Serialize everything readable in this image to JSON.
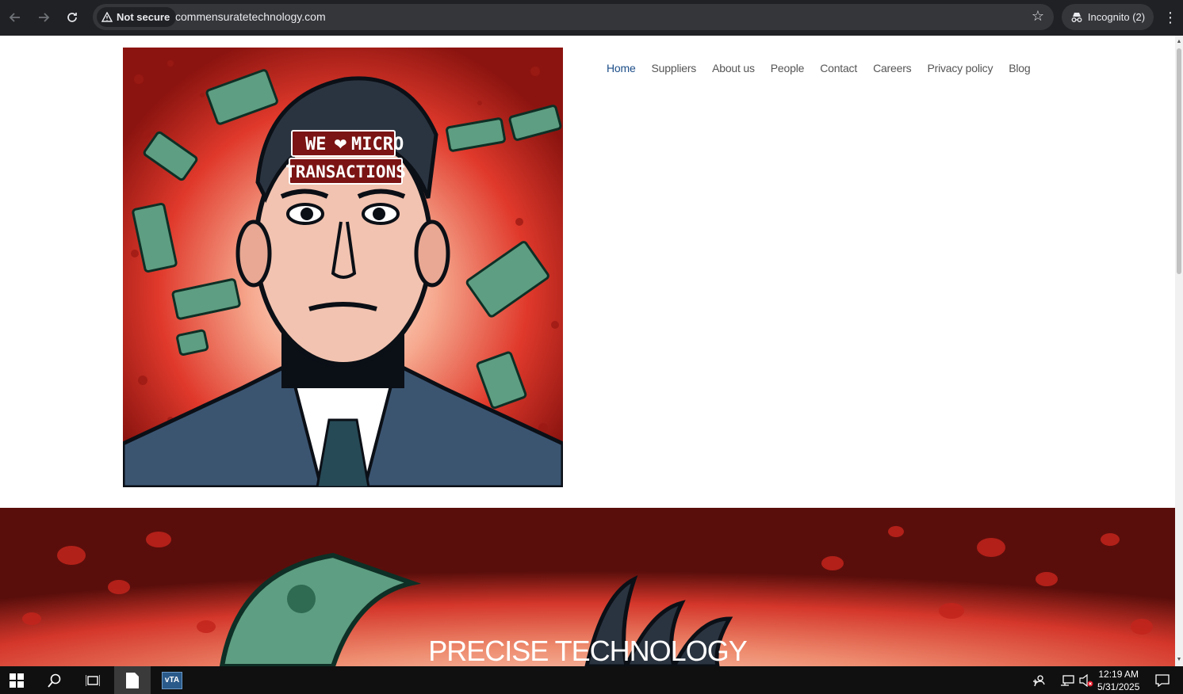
{
  "browser": {
    "back_icon": "arrow-left-icon",
    "forward_icon": "arrow-right-icon",
    "reload_icon": "reload-icon",
    "security_label": "Not secure",
    "url": "commensuratetechnology.com",
    "bookmark_icon": "star-icon",
    "profile_label": "Incognito (2)",
    "menu_icon": "kebab-menu-icon"
  },
  "site": {
    "hero_image": {
      "sign_line1_a": "WE",
      "sign_line1_b": "MICRO",
      "sign_line2": "TRANSACTIONS"
    },
    "nav": [
      {
        "label": "Home",
        "current": true
      },
      {
        "label": "Suppliers",
        "current": false
      },
      {
        "label": "About us",
        "current": false
      },
      {
        "label": "People",
        "current": false
      },
      {
        "label": "Contact",
        "current": false
      },
      {
        "label": "Careers",
        "current": false
      },
      {
        "label": "Privacy policy",
        "current": false
      },
      {
        "label": "Blog",
        "current": false
      }
    ],
    "banner_title": "PRECISE TECHNOLOGY"
  },
  "taskbar": {
    "time": "12:19 AM",
    "date": "5/31/2025",
    "app_label": "vTA"
  },
  "colors": {
    "chrome_bg": "#202124",
    "nav_active": "#1d4e89",
    "nav_text": "#555555",
    "hero_red": "#e0392b"
  }
}
